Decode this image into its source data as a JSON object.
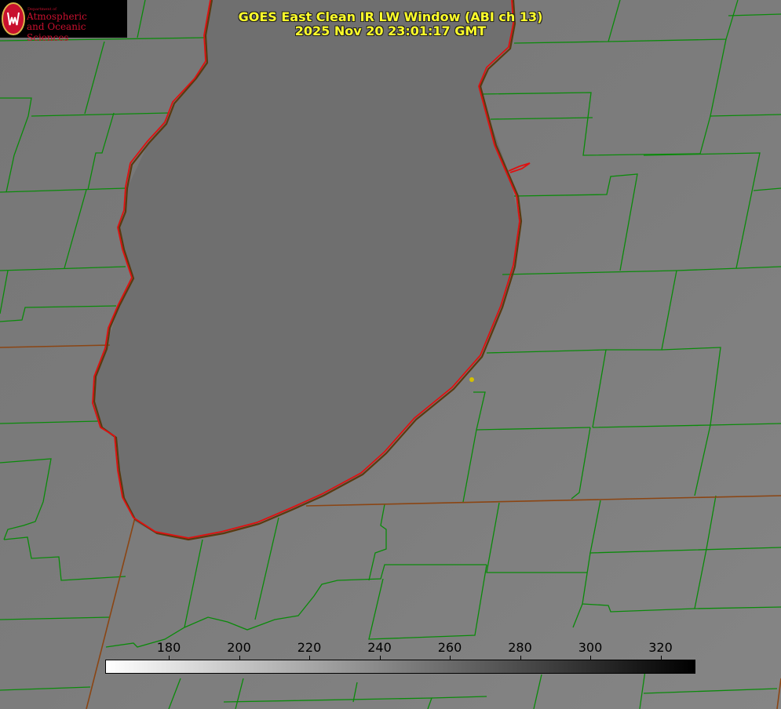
{
  "logo": {
    "dept": "Department of",
    "line1": "Atmospheric",
    "line2": "and Oceanic Sciences",
    "seal_icon": "uw-crest-icon"
  },
  "title": {
    "line1": "GOES East Clean IR LW Window (ABI ch 13)",
    "line2": "2025 Nov 20 23:01:17 GMT"
  },
  "colorbar": {
    "ticks": [
      "180",
      "200",
      "220",
      "240",
      "260",
      "280",
      "300",
      "320"
    ]
  },
  "colors": {
    "county_lines": "#0a8a0a",
    "state_lines": "#8b4513",
    "lake_outline": "#e01010",
    "title_text": "#ffff2a",
    "marker": "#d4c000"
  }
}
